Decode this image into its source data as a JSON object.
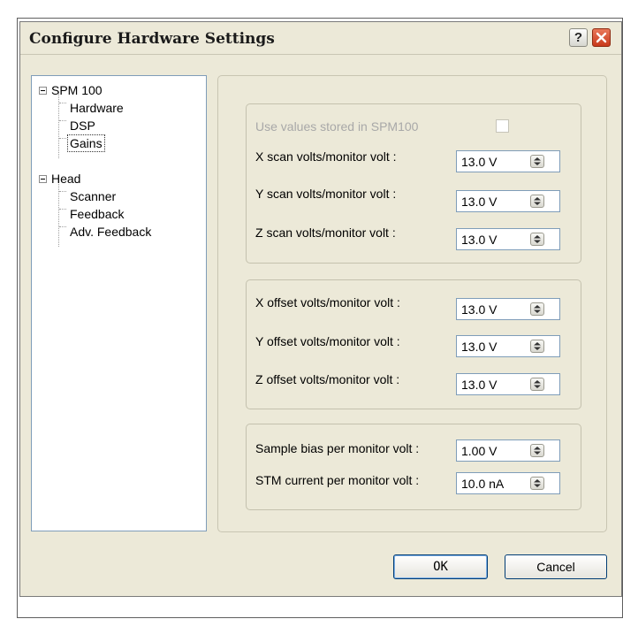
{
  "window": {
    "title": "Configure Hardware Settings",
    "help_label": "?"
  },
  "tree": {
    "root1": {
      "label": "SPM 100",
      "children": [
        "Hardware",
        "DSP",
        "Gains"
      ]
    },
    "root2": {
      "label": "Head",
      "children": [
        "Scanner",
        "Feedback",
        "Adv. Feedback"
      ]
    },
    "selected": "Gains"
  },
  "group1": {
    "use_stored_label": "Use values stored in SPM100",
    "use_stored_checked": false,
    "fields": [
      {
        "label": "X scan volts/monitor volt :",
        "value": "13.0 V"
      },
      {
        "label": "Y scan volts/monitor volt :",
        "value": "13.0 V"
      },
      {
        "label": "Z scan volts/monitor volt :",
        "value": "13.0 V"
      }
    ]
  },
  "group2": {
    "fields": [
      {
        "label": "X offset volts/monitor volt :",
        "value": "13.0 V"
      },
      {
        "label": "Y offset volts/monitor volt :",
        "value": "13.0 V"
      },
      {
        "label": "Z offset volts/monitor volt :",
        "value": "13.0 V"
      }
    ]
  },
  "group3": {
    "fields": [
      {
        "label": "Sample bias per monitor volt :",
        "value": "1.00 V"
      },
      {
        "label": "STM current per monitor volt :",
        "value": "10.0 nA"
      }
    ]
  },
  "buttons": {
    "ok": "OK",
    "cancel": "Cancel"
  }
}
